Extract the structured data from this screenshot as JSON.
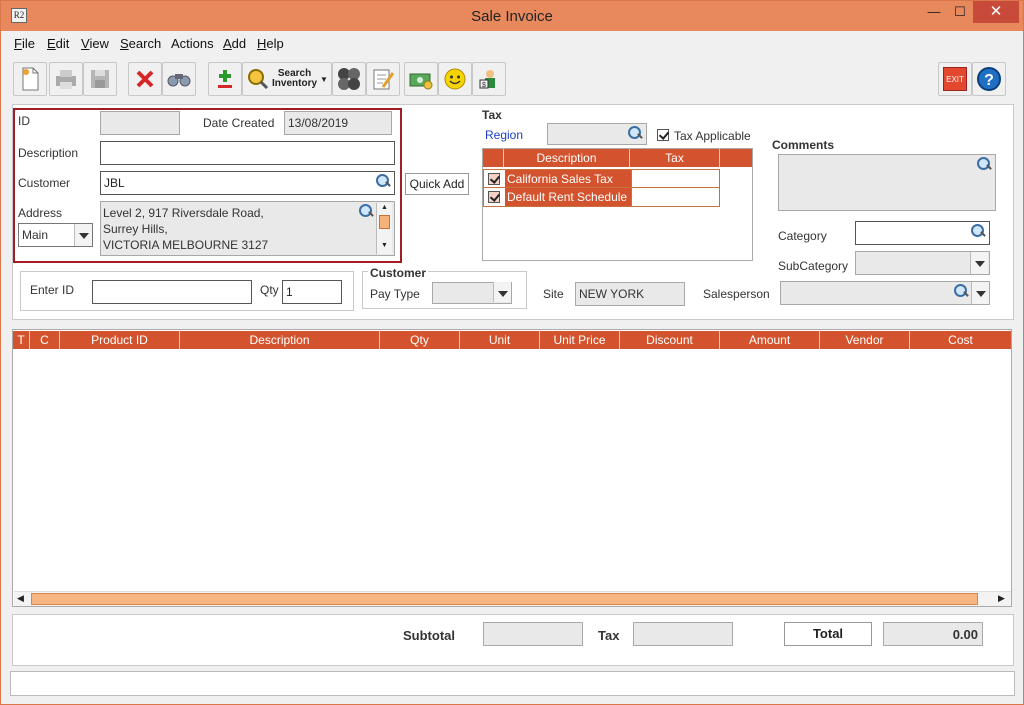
{
  "window": {
    "title": "Sale Invoice",
    "app_icon": "R2",
    "minimize": "—",
    "maximize": "☐",
    "close": "✕"
  },
  "menu": [
    "File",
    "Edit",
    "View",
    "Search",
    "Actions",
    "Add",
    "Help"
  ],
  "toolbar": {
    "search_inventory_line1": "Search",
    "search_inventory_line2": "Inventory",
    "exit_label": "EXIT",
    "help_label": "?"
  },
  "header_form": {
    "id_label": "ID",
    "id_value": "",
    "date_label": "Date Created",
    "date_value": "13/08/2019",
    "description_label": "Description",
    "description_value": "",
    "customer_label": "Customer",
    "customer_value": "JBL",
    "quick_add": "Quick Add",
    "address_label": "Address",
    "address_type": "Main",
    "address_lines": [
      "Level 2, 917 Riversdale Road,",
      "Surrey Hills,",
      "VICTORIA MELBOURNE 3127"
    ]
  },
  "tax": {
    "title": "Tax",
    "region_label": "Region",
    "region_value": "",
    "tax_applicable_label": "Tax Applicable",
    "columns": [
      "Description",
      "Tax"
    ],
    "rows": [
      {
        "description": "California Sales Tax",
        "tax": ""
      },
      {
        "description": "Default Rent Schedule",
        "tax": ""
      }
    ]
  },
  "comments": {
    "title": "Comments",
    "value": ""
  },
  "classification": {
    "category_label": "Category",
    "category_value": "",
    "subcategory_label": "SubCategory",
    "subcategory_value": ""
  },
  "entry": {
    "enter_id_label": "Enter ID",
    "enter_id_value": "",
    "qty_label": "Qty",
    "qty_value": "1"
  },
  "customer_box": {
    "title": "Customer",
    "pay_type_label": "Pay Type",
    "pay_type_value": ""
  },
  "site": {
    "label": "Site",
    "value": "NEW YORK"
  },
  "salesperson": {
    "label": "Salesperson",
    "value": ""
  },
  "grid": {
    "columns": [
      "T",
      "C",
      "Product ID",
      "Description",
      "Qty",
      "Unit",
      "Unit Price",
      "Discount",
      "Amount",
      "Vendor",
      "Cost"
    ]
  },
  "totals": {
    "subtotal_label": "Subtotal",
    "subtotal_value": "",
    "tax_label": "Tax",
    "tax_value": "",
    "total_label": "Total",
    "total_value": "0.00"
  },
  "colors": {
    "accent": "#d2532d",
    "titlebar": "#e8895d",
    "highlight_border": "#a31c23"
  }
}
